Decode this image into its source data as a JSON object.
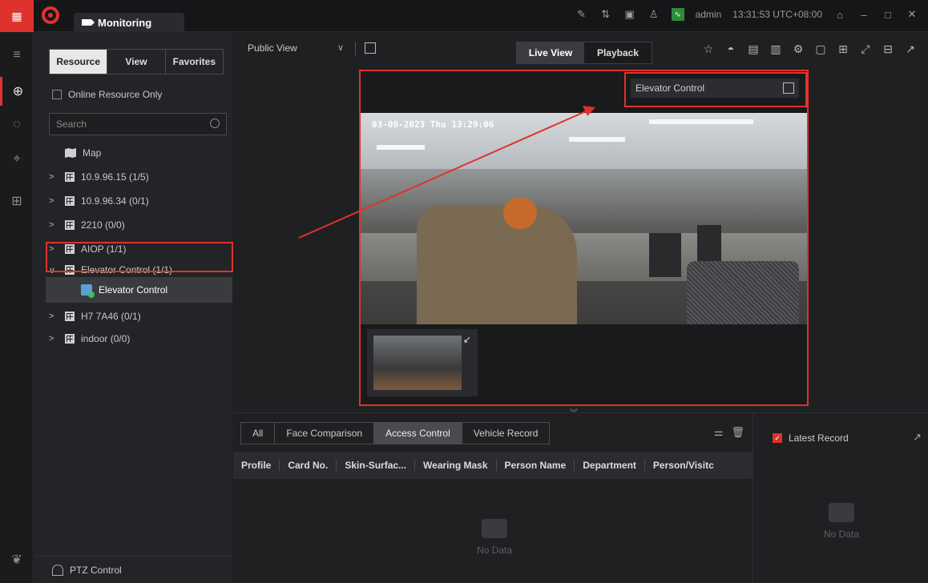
{
  "titlebar": {
    "tab_label": "Monitoring",
    "user": "admin",
    "time": "13:31:53 UTC+08:00",
    "accent": "#e0322d"
  },
  "resource_panel": {
    "segments": [
      "Resource",
      "View",
      "Favorites"
    ],
    "active_segment": "Resource",
    "online_only_label": "Online Resource Only",
    "search_placeholder": "Search",
    "tree": [
      {
        "label": "Map",
        "type": "map"
      },
      {
        "label": "10.9.96.15 (1/5)",
        "type": "area"
      },
      {
        "label": "10.9.96.34 (0/1)",
        "type": "area"
      },
      {
        "label": "2210 (0/0)",
        "type": "area"
      },
      {
        "label": "AIOP (1/1)",
        "type": "area"
      },
      {
        "label": "Elevator Control (1/1)",
        "type": "area",
        "expanded": true
      },
      {
        "label": "Elevator Control",
        "type": "elevator",
        "selected": true
      },
      {
        "label": "H7 7A46 (0/1)",
        "type": "area"
      },
      {
        "label": "indoor (0/0)",
        "type": "area"
      }
    ],
    "ptz_label": "PTZ Control"
  },
  "viewbar": {
    "view_name": "Public View",
    "modes": [
      "Live View",
      "Playback"
    ],
    "active_mode": "Live View"
  },
  "video": {
    "overlay_label": "Elevator Control",
    "osd_timestamp": "03-09-2023 Thu 13:29:06"
  },
  "events": {
    "tabs": [
      "All",
      "Face Comparison",
      "Access Control",
      "Vehicle Record"
    ],
    "active_tab": "Access Control",
    "columns": [
      "Profile",
      "Card No.",
      "Skin-Surfac...",
      "Wearing Mask",
      "Person Name",
      "Department",
      "Person/Visitc"
    ],
    "empty_text": "No Data"
  },
  "latest": {
    "label": "Latest Record",
    "checked": true,
    "empty_text": "No Data"
  }
}
